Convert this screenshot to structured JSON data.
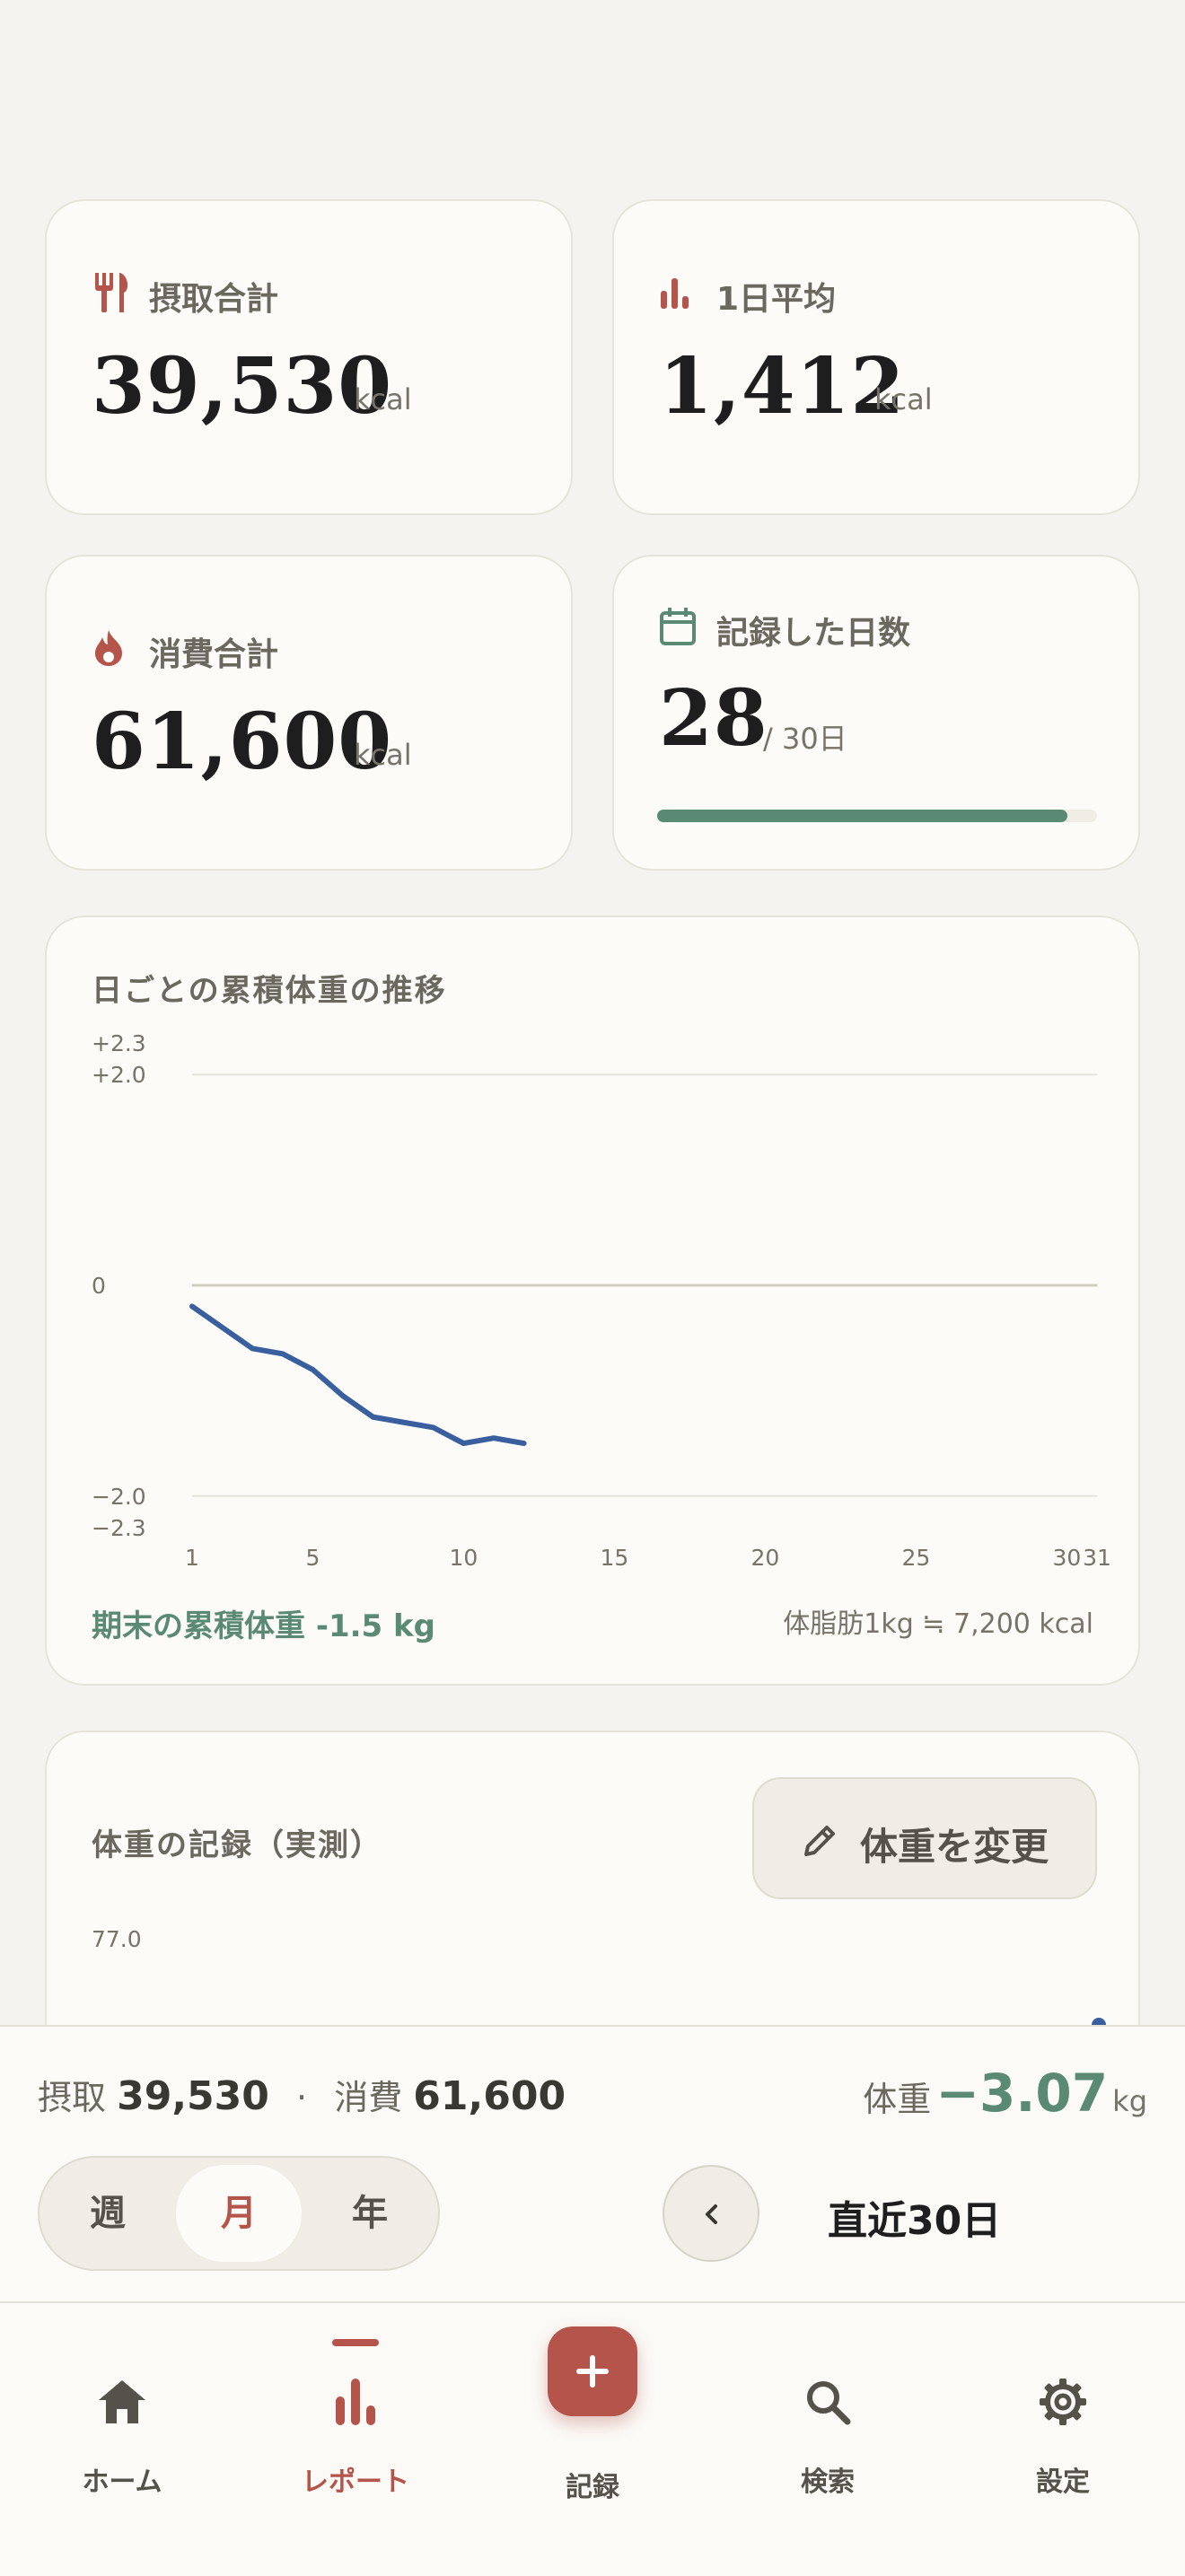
{
  "colors": {
    "accent": "#b5544a",
    "green": "#5a8a73",
    "line": "#3a5f9e",
    "text": "#1e1e1e"
  },
  "stats": {
    "intake": {
      "label": "摂取合計",
      "value": "39,530",
      "unit": "kcal",
      "icon": "fork-knife-icon"
    },
    "average": {
      "label": "1日平均",
      "value": "1,412",
      "unit": "kcal",
      "icon": "bar-chart-icon"
    },
    "burned": {
      "label": "消費合計",
      "value": "61,600",
      "unit": "kcal",
      "icon": "flame-icon"
    },
    "days": {
      "label": "記録した日数",
      "value": "28",
      "suffix": "/ 30日",
      "progress": 0.933,
      "icon": "calendar-icon"
    }
  },
  "cumulative": {
    "title": "日ごとの累積体重の推移",
    "footer_left": "期末の累積体重 -1.5 kg",
    "footer_right": "体脂肪1kg ≒ 7,200 kcal"
  },
  "chart_data": {
    "type": "line",
    "title": "日ごとの累積体重の推移",
    "xlabel": "",
    "ylabel": "",
    "xlim": [
      1,
      31
    ],
    "ylim": [
      -2.3,
      2.3
    ],
    "x_ticks": [
      "1",
      "5",
      "10",
      "15",
      "20",
      "25",
      "30",
      "31"
    ],
    "y_ticks": [
      "+2.3",
      "+2.0",
      "0",
      "−2.0",
      "−2.3"
    ],
    "grid": true,
    "series": [
      {
        "x": [
          1,
          2,
          3,
          4,
          5,
          6,
          7,
          8,
          9,
          10,
          11,
          12
        ],
        "y": [
          -0.2,
          -0.4,
          -0.6,
          -0.65,
          -0.8,
          -1.05,
          -1.25,
          -1.3,
          -1.35,
          -1.5,
          -1.45,
          -1.5
        ]
      }
    ]
  },
  "weight_record": {
    "title": "体重の記録（実測）",
    "button_label": "体重を変更",
    "y_tick_top": "77.0"
  },
  "summary": {
    "intake_label": "摂取",
    "intake_value": "39,530",
    "separator": "·",
    "burn_label": "消費",
    "burn_value": "61,600",
    "weight_label": "体重",
    "weight_value": "−3.07",
    "weight_unit": "kg"
  },
  "period": {
    "segments": [
      "週",
      "月",
      "年"
    ],
    "selected": "月",
    "range_label": "直近30日"
  },
  "nav": {
    "home": "ホーム",
    "report": "レポート",
    "record": "記録",
    "search": "検索",
    "settings": "設定"
  }
}
